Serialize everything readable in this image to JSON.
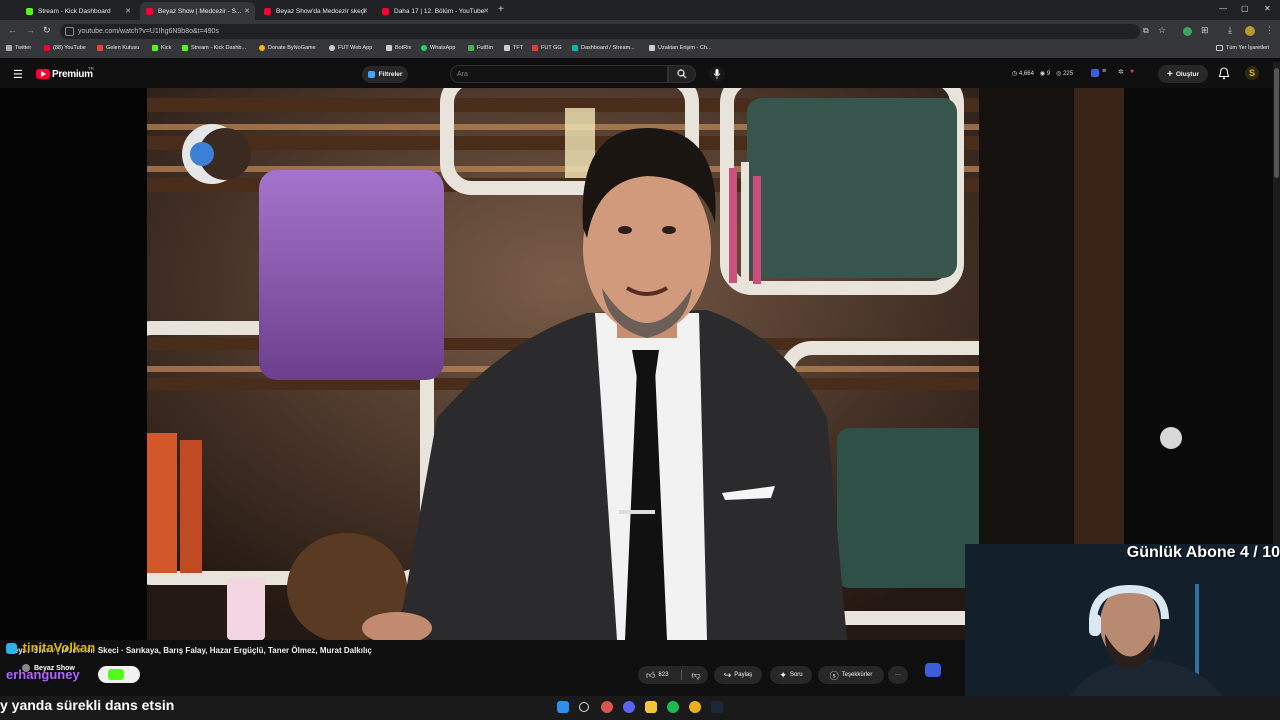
{
  "browser": {
    "tabs": [
      {
        "label": "Stream - Kick Dashboard",
        "color": "#53fc18",
        "active": false
      },
      {
        "label": "Beyaz Show | Medcezir - S...",
        "color": "#ff0033",
        "active": true
      },
      {
        "label": "Beyaz Show'da Medcezir skeçi",
        "color": "#ff0033",
        "active": false
      },
      {
        "label": "Daha 17 | 12. Bölüm - YouTube",
        "color": "#ff0033",
        "active": false
      }
    ],
    "new_tab": "+",
    "url": "youtube.com/watch?v=U1Ihg6N9b8o&t=490s",
    "bookmarks": [
      {
        "label": "Twitter",
        "color": "#aaaaaa"
      },
      {
        "label": "(88) YouTube",
        "color": "#ff0033"
      },
      {
        "label": "Gelen Kutusu",
        "color": "#ea4335"
      },
      {
        "label": "Kick",
        "color": "#53fc18"
      },
      {
        "label": "Stream - Kick Dashb...",
        "color": "#53fc18"
      },
      {
        "label": "Donate ByNoGame",
        "color": "#f5b400"
      },
      {
        "label": "FUT Web App",
        "color": "#cccccc"
      },
      {
        "label": "BotRix",
        "color": "#cccccc"
      },
      {
        "label": "WhatsApp",
        "color": "#25d366"
      },
      {
        "label": "FutBin",
        "color": "#4caf50"
      },
      {
        "label": "TFT",
        "color": "#cccccc"
      },
      {
        "label": "FUT GG",
        "color": "#e53935"
      },
      {
        "label": "Dashboard / Stream...",
        "color": "#00b7a8"
      },
      {
        "label": "Uzaktan Erişim - Ch...",
        "color": "#cccccc"
      }
    ],
    "all_bookmarks": "Tüm Yer İşaretleri"
  },
  "youtube": {
    "logo_text": "Premium",
    "logo_region": "TR",
    "filters_label": "Filtreler",
    "search_placeholder": "Ara",
    "header_stats": {
      "viewers": "4,664",
      "followers": "9",
      "count": "225"
    },
    "create_label": "Oluştur",
    "video_credits": "Beyaz Show | Medcezir Skeci · Sarıkaya, Barış Falay, Hazar Ergüçlü, Taner Ölmez, Murat Dalkılıç",
    "channel_name": "Beyaz Show",
    "actions": {
      "likes": "823",
      "share": "Paylaş",
      "ask": "Soru",
      "thanks": "Teşekkürler",
      "more": "···"
    }
  },
  "stream_overlay": {
    "sub_counter": "Günlük Abone 4 / 10",
    "chat_user_1": "tinitaVolkan",
    "chat_user_2": "erhanguney",
    "bottom_message": "y yanda sürekli dans etsin"
  },
  "colors": {
    "yt_red": "#ff0033",
    "kick_green": "#53fc18",
    "chat_gold": "#d9b800",
    "chat_purple": "#b266ff"
  }
}
